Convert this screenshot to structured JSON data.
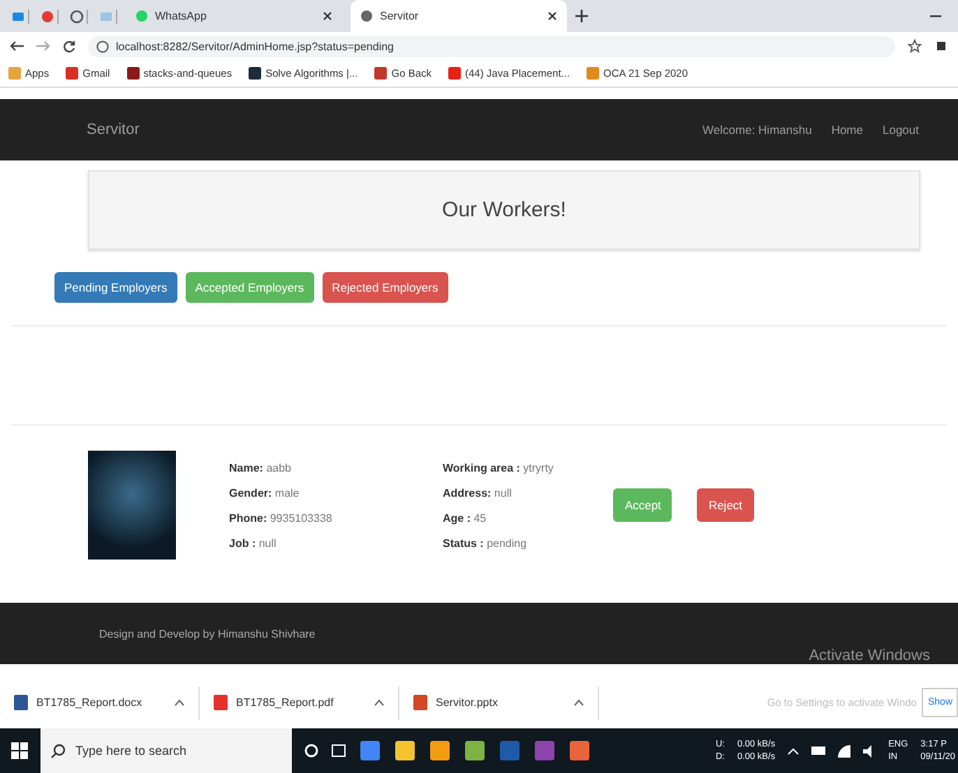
{
  "browser": {
    "tabs": [
      {
        "label": "WhatsApp",
        "selected": false
      },
      {
        "label": "Servitor",
        "selected": true
      }
    ],
    "address": "localhost:8282/Servitor/AdminHome.jsp?status=pending",
    "bookmarks": [
      {
        "label": "Apps",
        "color": "#e8a33c"
      },
      {
        "label": "Gmail",
        "color": "#d93025"
      },
      {
        "label": "stacks-and-queues",
        "color": "#8b1a1a"
      },
      {
        "label": "Solve Algorithms |...",
        "color": "#1e2b3a"
      },
      {
        "label": "Go Back",
        "color": "#c0392b"
      },
      {
        "label": "(44) Java Placement...",
        "color": "#e62117"
      },
      {
        "label": "OCA 21 Sep 2020",
        "color": "#e08a1e"
      }
    ]
  },
  "navbar": {
    "brand": "Servitor",
    "links": [
      "Welcome: Himanshu",
      "Home",
      "Logout"
    ]
  },
  "jumbotron": {
    "title": "Our Workers!"
  },
  "filters": [
    {
      "label": "Pending Employers",
      "kind": "primary"
    },
    {
      "label": "Accepted Employers",
      "kind": "success"
    },
    {
      "label": "Rejected Employers",
      "kind": "danger"
    }
  ],
  "worker": {
    "columns": [
      [
        {
          "label": "Name:",
          "value": "aabb"
        },
        {
          "label": "Gender:",
          "value": "male"
        },
        {
          "label": "Phone:",
          "value": "9935103338"
        },
        {
          "label": "Job :",
          "value": "null"
        }
      ],
      [
        {
          "label": "Working area :",
          "value": "ytryrty"
        },
        {
          "label": "Address:",
          "value": "null"
        },
        {
          "label": "Age :",
          "value": "45"
        },
        {
          "label": "Status :",
          "value": "pending"
        }
      ]
    ],
    "actions": [
      {
        "label": "Accept",
        "kind": "success"
      },
      {
        "label": "Reject",
        "kind": "danger"
      }
    ]
  },
  "footer": "Design and Develop by Himanshu Shivhare",
  "downloads": [
    {
      "name": "BT1785_Report.docx",
      "color": "#2b5797"
    },
    {
      "name": "BT1785_Report.pdf",
      "color": "#e2322b"
    },
    {
      "name": "Servitor.pptx",
      "color": "#d24726"
    }
  ],
  "activation": {
    "title": "Activate Windows",
    "subtitle": "Go to Settings to activate Windo",
    "button": "Show"
  },
  "taskbar": {
    "search_placeholder": "Type here to search",
    "apps": [
      {
        "color": "#4285f4"
      },
      {
        "color": "#f4c430"
      },
      {
        "color": "#f39c12"
      },
      {
        "color": "#7cb342"
      },
      {
        "color": "#1e5aa8"
      },
      {
        "color": "#8e44ad"
      },
      {
        "color": "#e8643a"
      }
    ],
    "up_label": "U:",
    "down_label": "D:",
    "up_rate": "0.00 kB/s",
    "down_rate": "0.00 kB/s",
    "lang": "ENG",
    "region": "IN",
    "time": "3:17 P",
    "date": "09/11/20"
  }
}
